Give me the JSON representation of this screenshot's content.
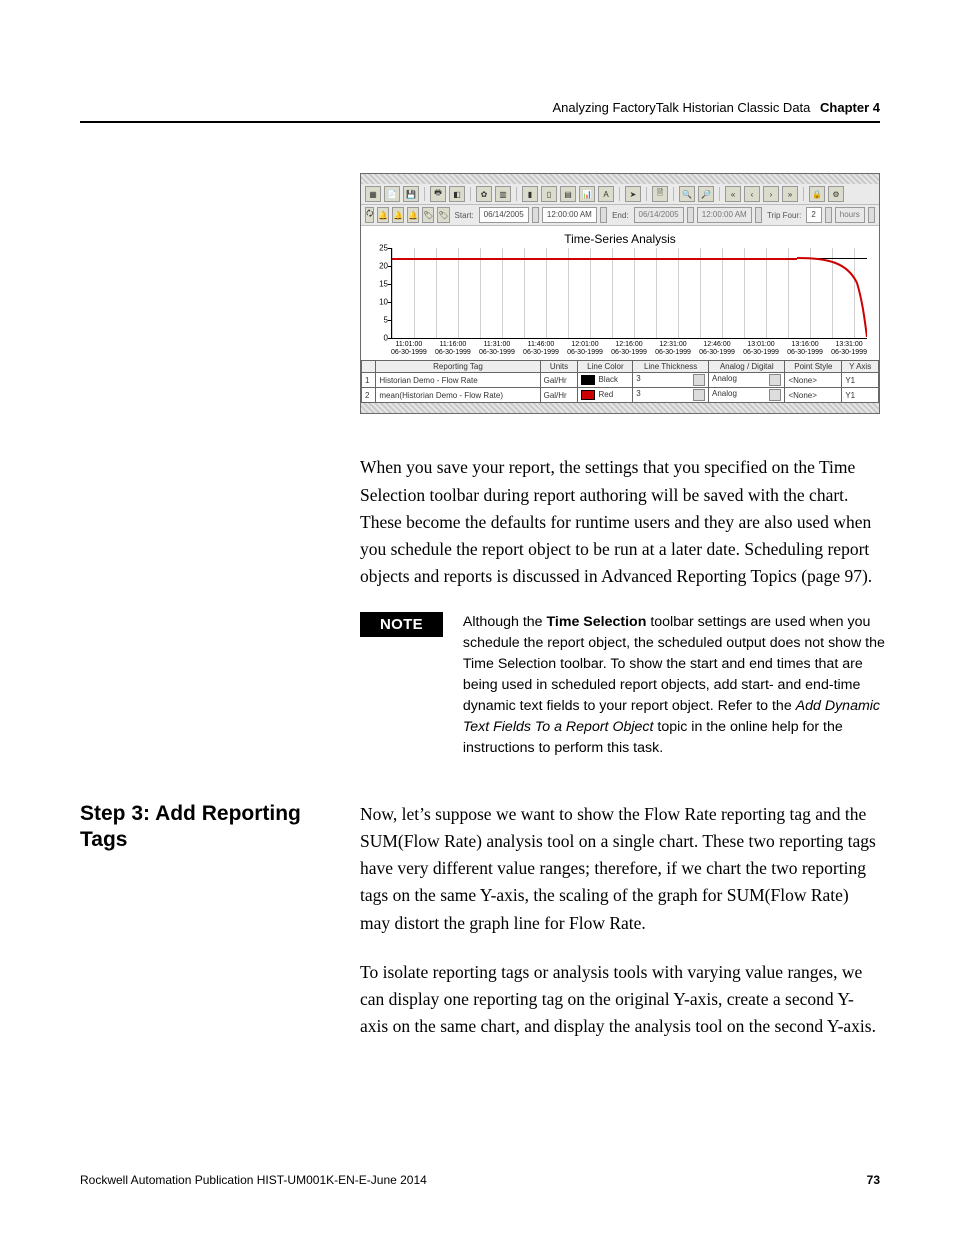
{
  "header": {
    "title": "Analyzing FactoryTalk Historian Classic Data",
    "chapter": "Chapter 4"
  },
  "figure": {
    "toolbar_start_label": "Start:",
    "toolbar_end_label": "End:",
    "toolbar_trip_label": "Trip Four:",
    "start_date": "06/14/2005",
    "start_time": "12:00:00 AM",
    "end_date": "06/14/2005",
    "end_time": "12:00:00 AM",
    "trip_value": "2",
    "trip_unit": "hours",
    "glyph_A": "A",
    "glyph_arrow": "➤",
    "glyph_doc": "🗎",
    "glyph_first": "«",
    "glyph_prev": "‹",
    "glyph_next": "›",
    "glyph_last": "»",
    "glyph_lock": "🔒",
    "chart_title": "Time-Series Analysis",
    "legend": {
      "headers": [
        "",
        "Reporting Tag",
        "Units",
        "Line Color",
        "Line Thickness",
        "Analog / Digital",
        "Point Style",
        "Y Axis"
      ],
      "rows": [
        {
          "n": "1",
          "tag": "Historian Demo - Flow Rate",
          "units": "Gal/Hr",
          "color": "Black",
          "thick": "3",
          "ad": "Analog",
          "ps": "<None>",
          "y": "Y1"
        },
        {
          "n": "2",
          "tag": "mean(Historian Demo - Flow Rate)",
          "units": "Gal/Hr",
          "color": "Red",
          "thick": "3",
          "ad": "Analog",
          "ps": "<None>",
          "y": "Y1"
        }
      ]
    }
  },
  "chart_data": {
    "type": "line",
    "title": "Time-Series Analysis",
    "ylabel": "",
    "xlabel": "",
    "ylim": [
      0,
      25
    ],
    "yticks": [
      0,
      5,
      10,
      15,
      20,
      25
    ],
    "categories": [
      "11:01:00 06-30-1999",
      "11:16:00 06-30-1999",
      "11:31:00 06-30-1999",
      "11:46:00 06-30-1999",
      "12:01:00 06-30-1999",
      "12:16:00 06-30-1999",
      "12:31:00 06-30-1999",
      "12:46:00 06-30-1999",
      "13:01:00 06-30-1999",
      "13:16:00 06-30-1999",
      "13:31:00 06-30-1999"
    ],
    "series": [
      {
        "name": "Historian Demo - Flow Rate",
        "color": "#000000",
        "values": [
          22,
          22,
          22,
          22,
          22,
          22,
          22,
          22,
          22,
          22,
          22
        ]
      },
      {
        "name": "mean(Historian Demo - Flow Rate)",
        "color": "#c00000",
        "values": [
          22,
          22,
          22,
          22,
          22,
          22,
          22,
          22,
          21,
          18,
          1
        ]
      }
    ]
  },
  "para1": "When you save your report, the settings that you specified on the Time Selection toolbar during report authoring will be saved with the chart. These become the defaults for runtime users and they are also used when you schedule the report object to be run at a later date. Scheduling report objects and reports is discussed in Advanced Reporting Topics (page 97).",
  "note": {
    "badge": "NOTE",
    "t1": "Although the ",
    "bold": "Time Selection",
    "t2": " toolbar settings are used when you schedule the report object, the scheduled output does not show the Time Selection toolbar. To show the start and end times that are being used in scheduled report objects, add start- and end-time dynamic text fields to your report object. Refer to the ",
    "ital": "Add Dynamic Text Fields To a Report Object",
    "t3": " topic in the online help for the instructions to perform this task."
  },
  "step3": {
    "heading": "Step 3: Add Reporting Tags",
    "p1": "Now, let’s suppose we want to show the Flow Rate reporting tag and the SUM(Flow Rate) analysis tool on a single chart. These two reporting tags have very different value ranges; therefore, if we chart the two reporting tags on the same Y-axis, the scaling of the graph for SUM(Flow Rate) may distort the graph line for Flow Rate.",
    "p2": "To isolate reporting tags or analysis tools with varying value ranges, we can display one reporting tag on the original Y-axis, create a second Y-axis on the same chart, and display the analysis tool on the second Y-axis."
  },
  "footer": {
    "pub": "Rockwell Automation Publication HIST-UM001K-EN-E-June 2014",
    "page": "73"
  }
}
